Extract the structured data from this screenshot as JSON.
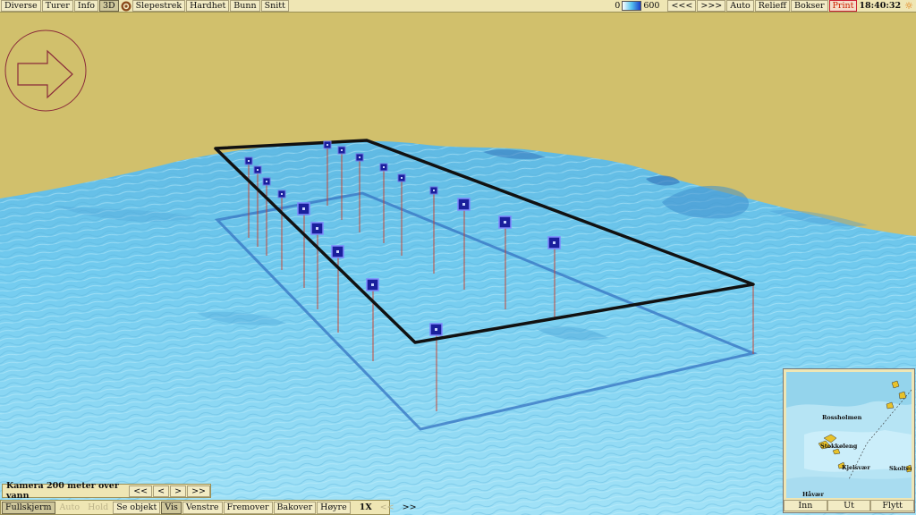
{
  "top_menu": {
    "items": [
      "Diverse",
      "Turer",
      "Info",
      "3D"
    ],
    "items2": [
      "Slepestrek",
      "Hardhet",
      "Bunn",
      "Snitt"
    ],
    "scale_min": "0",
    "scale_max": "600",
    "prev": "<<<",
    "next": ">>>",
    "auto": "Auto",
    "relief": "Relieff",
    "boxes": "Bokser",
    "print": "Print",
    "clock": "18:40:32"
  },
  "camera": {
    "label": "Kamera 200 meter over vann",
    "buttons": [
      "<<",
      "<",
      ">",
      ">>"
    ]
  },
  "bottom_bar": {
    "fullscreen": "Fullskjerm",
    "auto": "Auto",
    "hold": "Hold",
    "see_object": "Se objekt",
    "show": "Vis",
    "left": "Venstre",
    "forward": "Fremover",
    "backward": "Bakover",
    "right": "Høyre",
    "speed": "1X",
    "speed_down": "<<",
    "speed_up": ">>"
  },
  "minimap": {
    "places": [
      "Rossholmen",
      "Stokkøleng",
      "Kjelsvær",
      "Skolten",
      "Håvær"
    ],
    "buttons": [
      "Inn",
      "Ut",
      "Flytt"
    ]
  },
  "colors": {
    "sky": "#d1c06c",
    "sea": "#6bc8ec",
    "track": "#111111",
    "marker": "#1a1f9c"
  },
  "icons": [
    "arrow-right-icon",
    "compass-rose-icon",
    "sun-icon"
  ]
}
